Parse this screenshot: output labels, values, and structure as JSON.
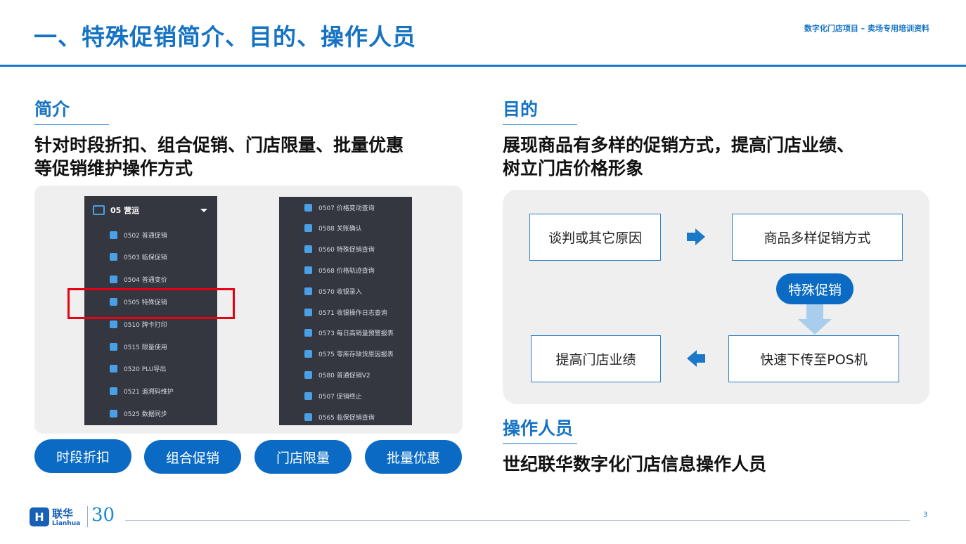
{
  "header": {
    "title": "一、特殊促销简介、目的、操作人员",
    "subtitle": "数字化门店项目 – 卖场专用培训资料"
  },
  "intro": {
    "heading": "简介",
    "text_line1": "针对时段折扣、组合促销、门店限量、批量优惠",
    "text_line2": "等促销维护操作方式"
  },
  "menu_left": {
    "header": "05 营运",
    "items": [
      {
        "label": "0502 普通促销",
        "icon": "percent-icon"
      },
      {
        "label": "0503 临保促销",
        "icon": "shield-icon"
      },
      {
        "label": "0504 普通变价",
        "icon": "cart-icon"
      },
      {
        "label": "0505 特殊促销",
        "icon": "star-icon"
      },
      {
        "label": "0510 牌卡打印",
        "icon": "shield-icon"
      },
      {
        "label": "0515 限量使用",
        "icon": "shield-check-icon"
      },
      {
        "label": "0520 PLU导出",
        "icon": "upload-icon"
      },
      {
        "label": "0521 追溯码维护",
        "icon": "cart-icon"
      },
      {
        "label": "0525 数据同步",
        "icon": "cloud-icon"
      }
    ]
  },
  "menu_right": {
    "items": [
      {
        "label": "0507 价格变动查询",
        "icon": "shield-icon"
      },
      {
        "label": "0588 关账确认",
        "icon": "cart-icon"
      },
      {
        "label": "0560 特殊促销查询",
        "icon": "cart-icon"
      },
      {
        "label": "0568 价格轨迹查询",
        "icon": "cart-icon"
      },
      {
        "label": "0570 收银录入",
        "icon": "cart-icon"
      },
      {
        "label": "0571 收银操作日志查询",
        "icon": "cart-icon"
      },
      {
        "label": "0573 每日高销量预警报表",
        "icon": "cart-icon"
      },
      {
        "label": "0575 零库存缺货原因报表",
        "icon": "cart-icon"
      },
      {
        "label": "0580 普通促销V2",
        "icon": "cart-icon"
      },
      {
        "label": "0507 促销终止",
        "icon": "cart-icon"
      },
      {
        "label": "0565 临保促销查询",
        "icon": "cart-icon"
      }
    ]
  },
  "pills": [
    "时段折扣",
    "组合促销",
    "门店限量",
    "批量优惠"
  ],
  "purpose": {
    "heading": "目的",
    "text_line1": "展现商品有多样的促销方式，提高门店业绩、",
    "text_line2": "树立门店价格形象"
  },
  "flow": {
    "box1": "谈判或其它原因",
    "box2": "商品多样促销方式",
    "pill": "特殊促销",
    "box3": "快速下传至POS机",
    "box4": "提高门店业绩"
  },
  "operators": {
    "heading": "操作人员",
    "text": "世纪联华数字化门店信息操作人员"
  },
  "footer": {
    "logo_cn": "联华",
    "logo_en": "Lianhua",
    "logo_30": "30",
    "page_number": "3"
  },
  "colors": {
    "brand_blue": "#1573c4",
    "pill_blue": "#0b6bc4",
    "menu_bg": "#343640",
    "highlight_red": "#e60012"
  }
}
